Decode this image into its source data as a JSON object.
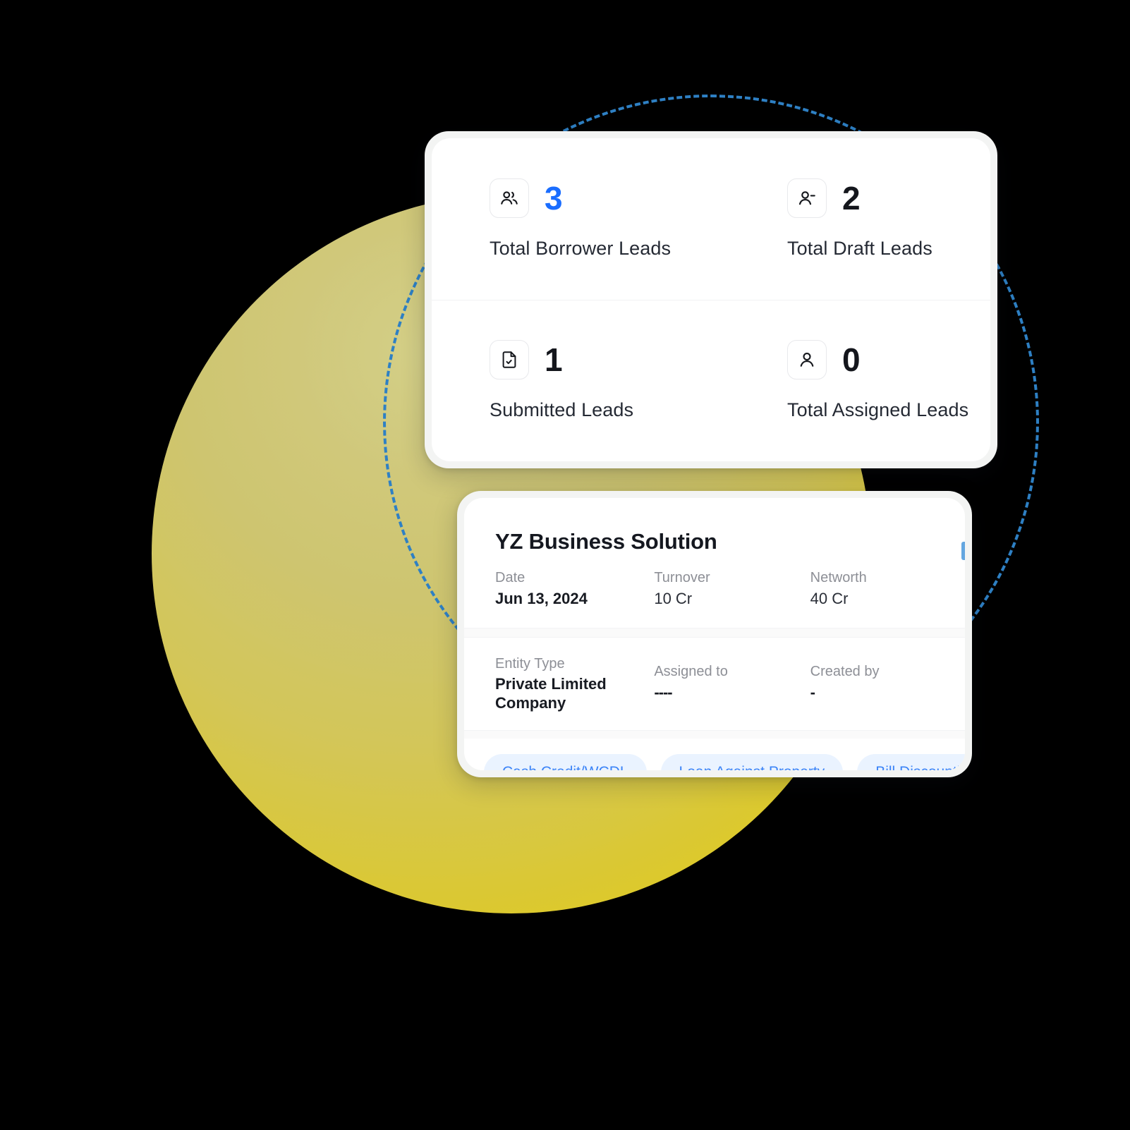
{
  "theme": {
    "accent_blue": "#1a6dff",
    "chip_text": "#3c84f7",
    "chip_bg": "#eaf3ff",
    "dotted_circle": "#2e80c4",
    "orb_from": "#d4cf8a",
    "orb_to": "#e2cd14",
    "text_dark": "#14161c",
    "muted": "#8d8f96"
  },
  "stats_card": {
    "cells": [
      {
        "icon": "users-icon",
        "value": "3",
        "label": "Total Borrower Leads",
        "value_accent": true
      },
      {
        "icon": "user-minus-icon",
        "value": "2",
        "label": "Total Draft Leads",
        "value_accent": false
      },
      {
        "icon": "document-check-icon",
        "value": "1",
        "label": "Submitted Leads",
        "value_accent": false
      },
      {
        "icon": "user-icon",
        "value": "0",
        "label": "Total Assigned Leads",
        "value_accent": false
      }
    ]
  },
  "lead_card": {
    "title": "YZ Business Solution",
    "row1": [
      {
        "label": "Date",
        "value": "Jun 13, 2024"
      },
      {
        "label": "Turnover",
        "value": "10 Cr"
      },
      {
        "label": "Networth",
        "value": "40 Cr"
      }
    ],
    "row2": [
      {
        "label": "Entity Type",
        "value": "Private Limited Company"
      },
      {
        "label": "Assigned to",
        "value": "----"
      },
      {
        "label": "Created by",
        "value": "-"
      }
    ],
    "chips": [
      "Cash Credit/WCDL",
      "Loan Against Property",
      "Bill Discounting Purchase"
    ]
  }
}
